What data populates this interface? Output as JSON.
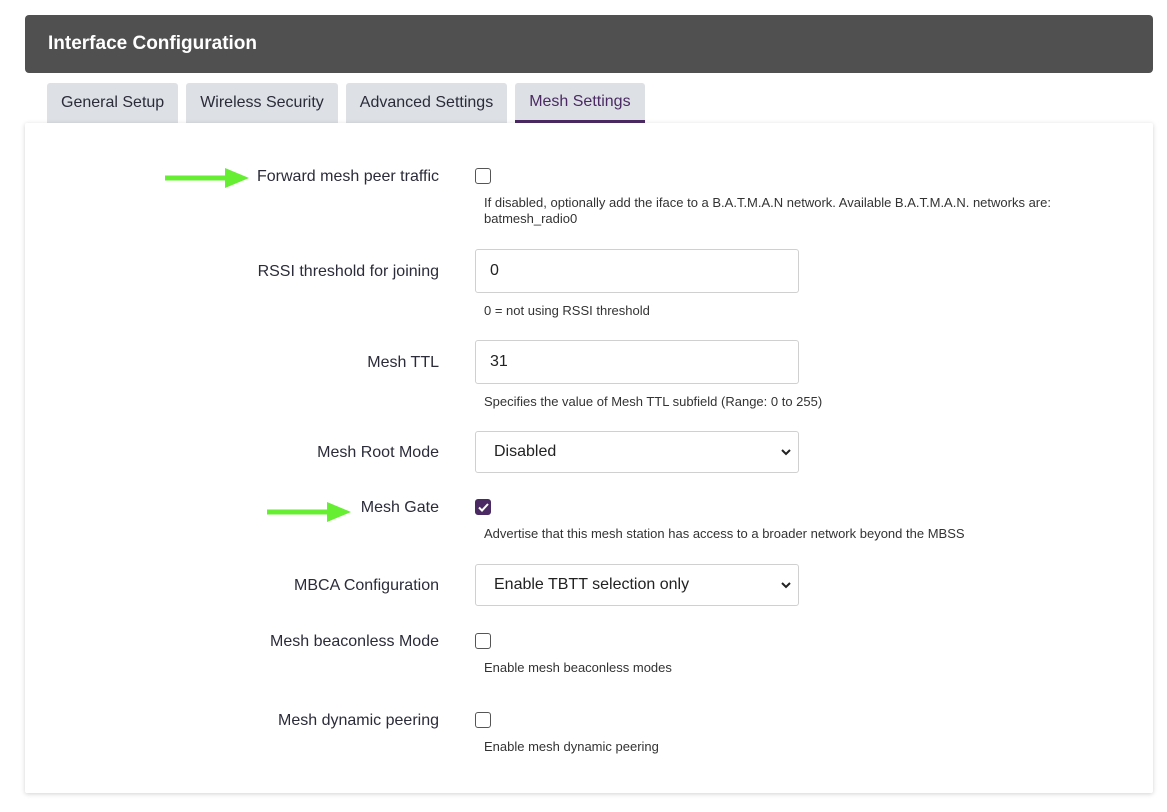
{
  "header": {
    "title": "Interface Configuration"
  },
  "tabs": [
    {
      "label": "General Setup"
    },
    {
      "label": "Wireless Security"
    },
    {
      "label": "Advanced Settings"
    },
    {
      "label": "Mesh Settings"
    }
  ],
  "fields": {
    "forward": {
      "label": "Forward mesh peer traffic",
      "checked": false,
      "desc": "If disabled, optionally add the iface to a B.A.T.M.A.N network. Available B.A.T.M.A.N. networks are: batmesh_radio0"
    },
    "rssi": {
      "label": "RSSI threshold for joining",
      "value": "0",
      "desc": "0 = not using RSSI threshold"
    },
    "ttl": {
      "label": "Mesh TTL",
      "value": "31",
      "desc": "Specifies the value of Mesh TTL subfield (Range: 0 to 255)"
    },
    "root_mode": {
      "label": "Mesh Root Mode",
      "value": "Disabled"
    },
    "gate": {
      "label": "Mesh Gate",
      "checked": true,
      "desc": "Advertise that this mesh station has access to a broader network beyond the MBSS"
    },
    "mbca": {
      "label": "MBCA Configuration",
      "value": "Enable TBTT selection only"
    },
    "beaconless": {
      "label": "Mesh beaconless Mode",
      "checked": false,
      "desc": "Enable mesh beaconless modes"
    },
    "dynamic": {
      "label": "Mesh dynamic peering",
      "checked": false,
      "desc": "Enable mesh dynamic peering"
    }
  },
  "colors": {
    "accent": "#4b2a63",
    "header_bg": "#505050",
    "arrow": "#66ee33"
  },
  "icons": {
    "arrow": "right-arrow-icon",
    "check": "check-icon",
    "chevron": "chevron-down-icon"
  }
}
